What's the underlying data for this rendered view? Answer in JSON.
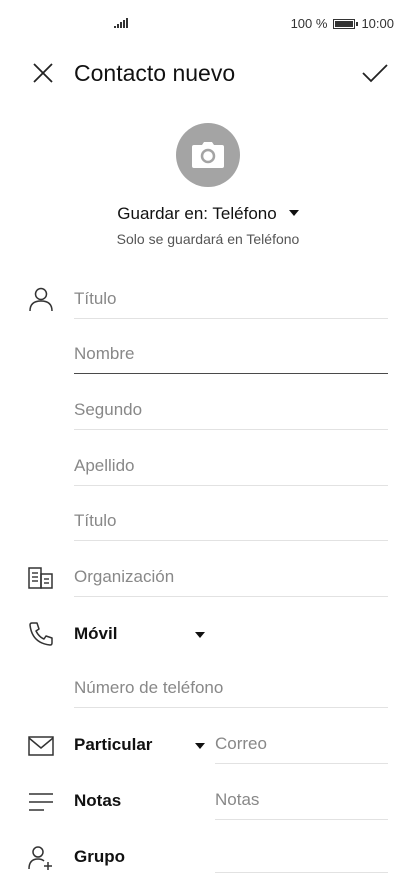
{
  "status": {
    "battery_text": "100 %",
    "time": "10:00"
  },
  "header": {
    "title": "Contacto nuevo",
    "close_icon": "close-icon",
    "confirm_icon": "check-icon"
  },
  "photo": {
    "icon": "camera-icon"
  },
  "storage": {
    "label": "Guardar en: Teléfono",
    "subtitle": "Solo se guardará en Teléfono"
  },
  "name_fields": {
    "prefix_placeholder": "Título",
    "first_placeholder": "Nombre",
    "middle_placeholder": "Segundo",
    "last_placeholder": "Apellido",
    "suffix_placeholder": "Título"
  },
  "organization": {
    "placeholder": "Organización"
  },
  "phone": {
    "type_label": "Móvil",
    "placeholder": "Número de teléfono"
  },
  "email": {
    "type_label": "Particular",
    "placeholder": "Correo"
  },
  "notes": {
    "label": "Notas",
    "placeholder": "Notas"
  },
  "group": {
    "label": "Grupo"
  }
}
